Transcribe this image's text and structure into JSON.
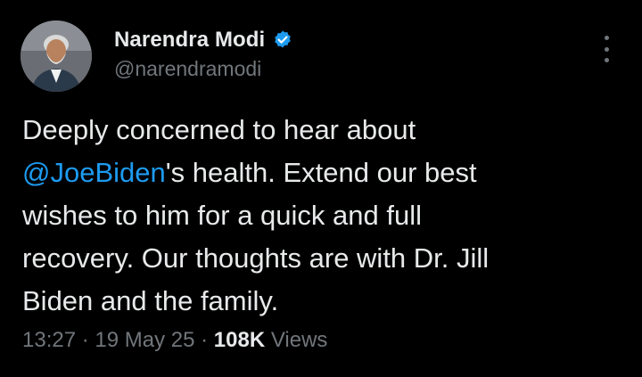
{
  "author": {
    "display_name": "Narendra Modi",
    "handle": "@narendramodi",
    "verified": true,
    "verified_color": "#1d9bf0"
  },
  "tweet": {
    "line_1": "Deeply concerned to hear about",
    "mention": "@JoeBiden",
    "line_2_rest": "'s health. Extend our best",
    "line_3": "wishes to him for a quick and full",
    "line_4": "recovery. Our thoughts are with Dr. Jill",
    "line_5": "Biden and the family.",
    "mention_color": "#1d9bf0"
  },
  "meta": {
    "time": "13:27",
    "separator": " · ",
    "date": "19 May 25",
    "views_count": "108K",
    "views_label": " Views"
  },
  "icons": {
    "more": "more-vertical-icon",
    "verified": "verified-badge-icon"
  },
  "colors": {
    "background": "#000000",
    "text_primary": "#e7e9ea",
    "text_secondary": "#71767b"
  }
}
